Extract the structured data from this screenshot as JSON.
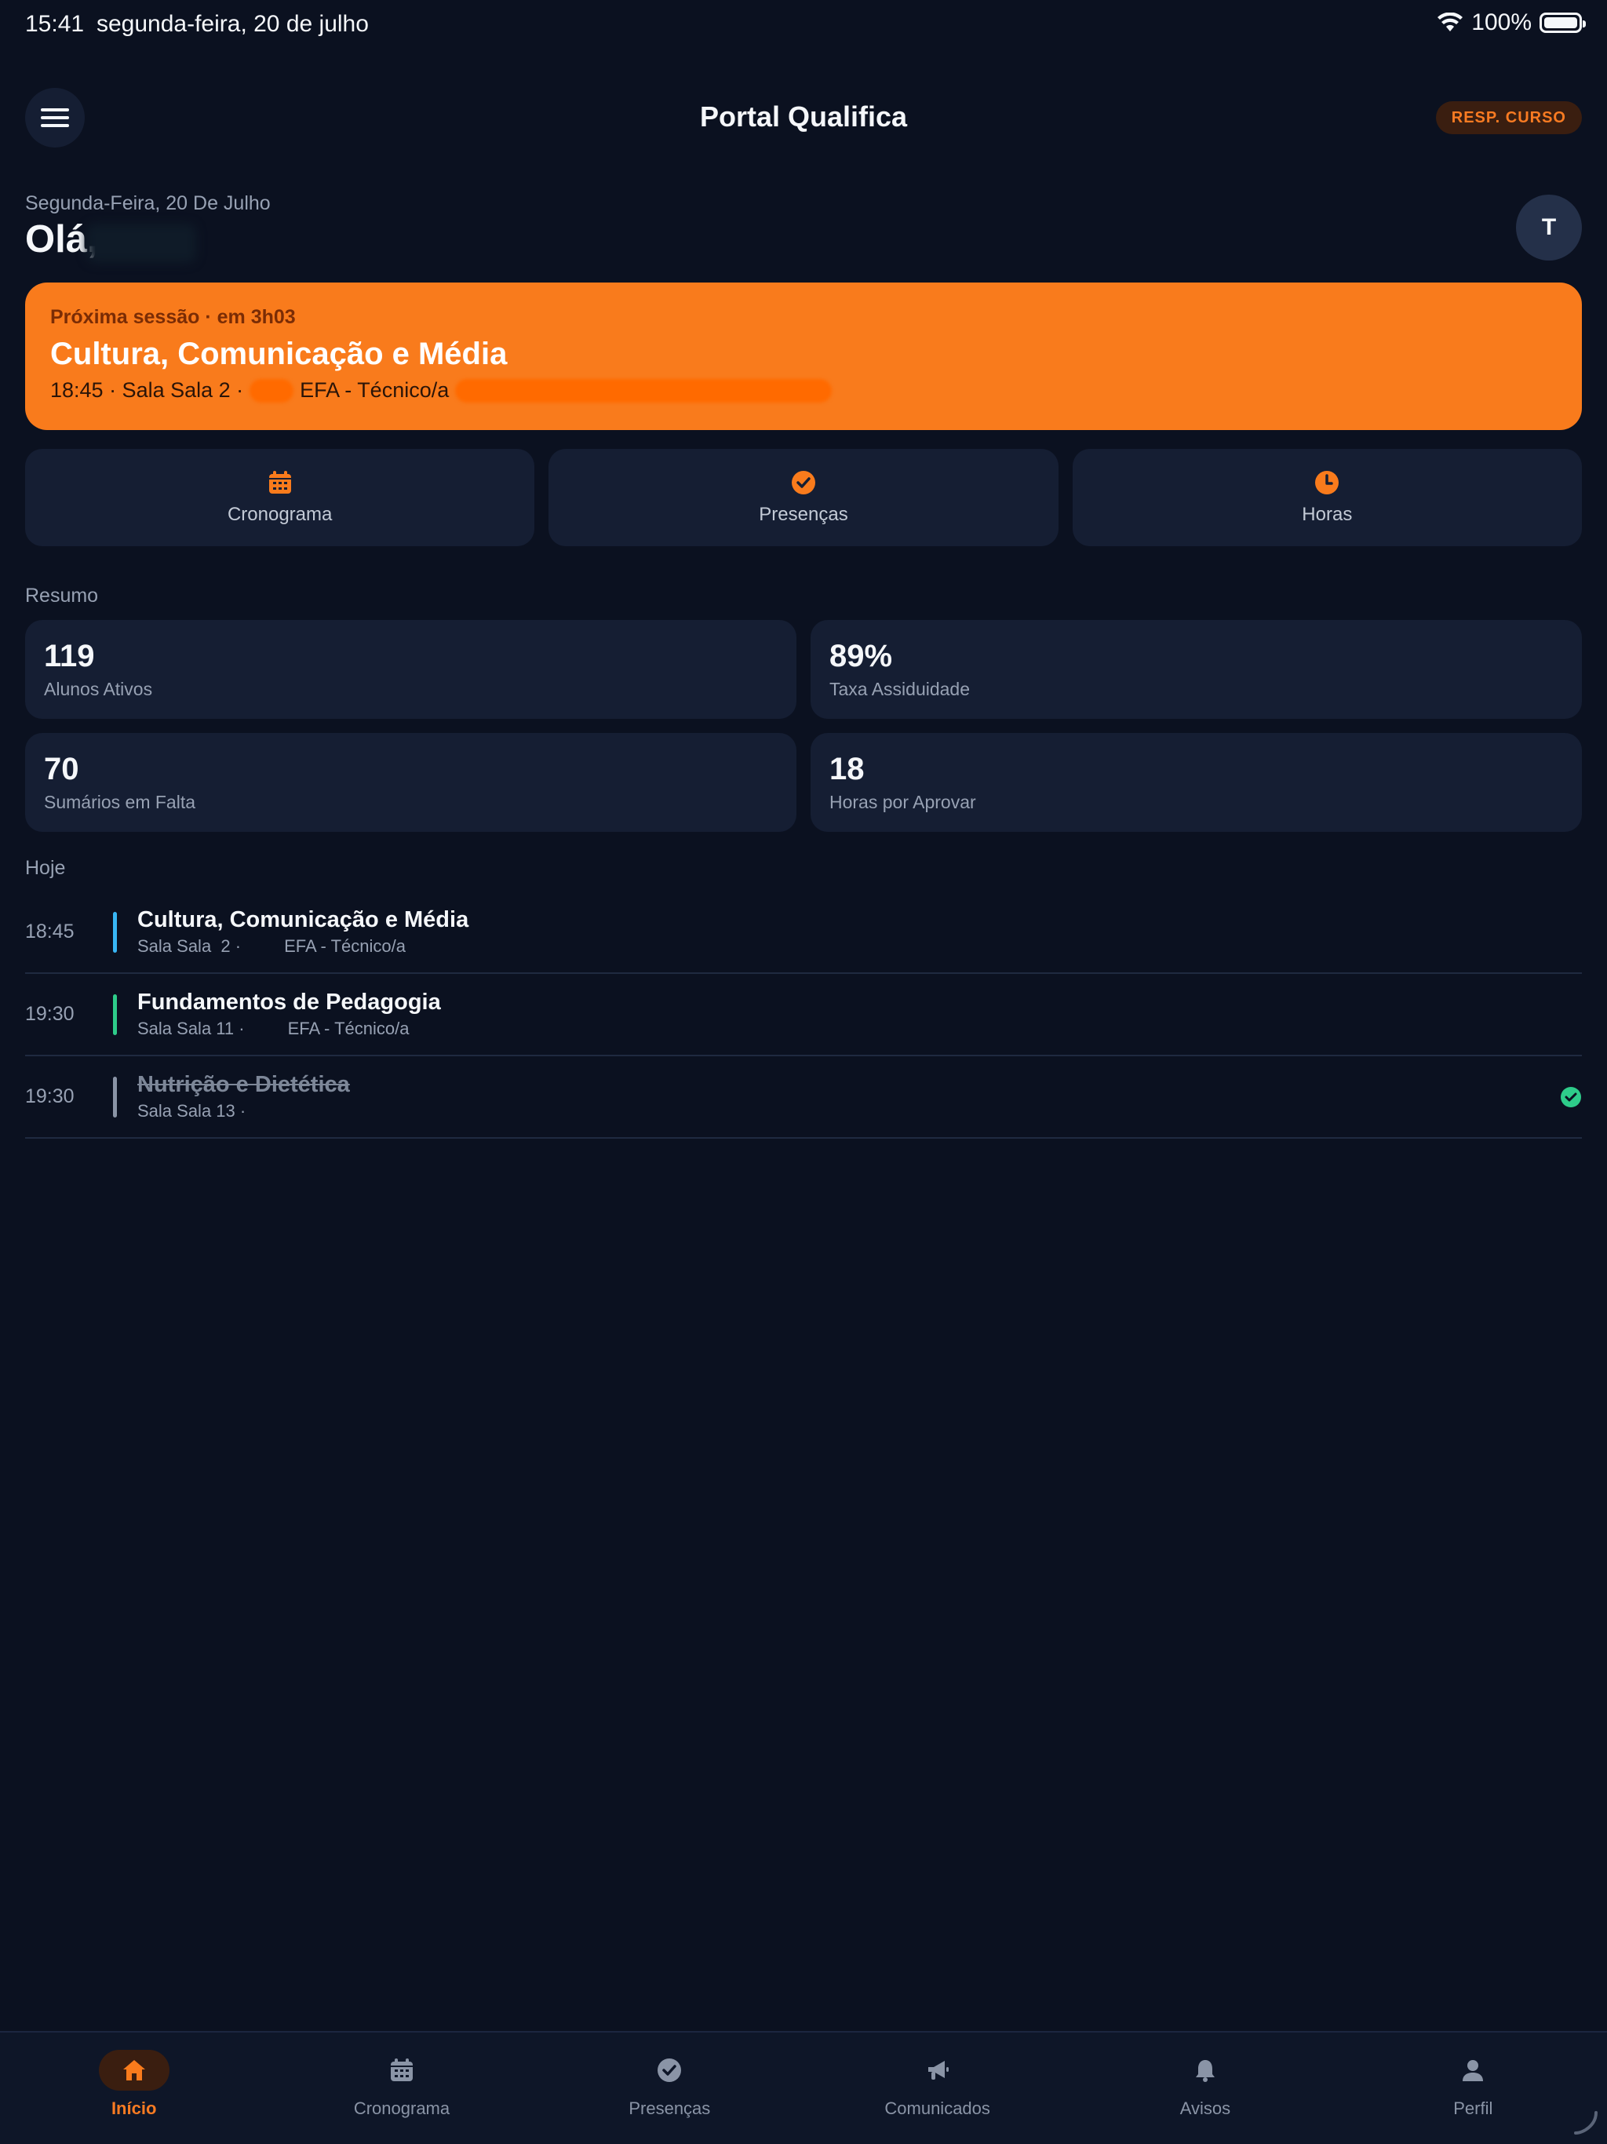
{
  "status_bar": {
    "time": "15:41",
    "date": "segunda-feira, 20 de julho",
    "battery": "100%"
  },
  "header": {
    "title": "Portal Qualifica",
    "role_badge": "RESP. CURSO"
  },
  "greeting": {
    "date": "Segunda-Feira, 20 De Julho",
    "hello": "Olá,",
    "avatar_initial": "T"
  },
  "next_session": {
    "label": "Próxima sessão · em 3h03",
    "title": "Cultura, Comunicação e Média",
    "meta_prefix": "18:45 · Sala Sala  2 ·",
    "meta_course": "EFA - Técnico/a"
  },
  "quick_actions": [
    {
      "label": "Cronograma",
      "icon": "calendar-icon"
    },
    {
      "label": "Presenças",
      "icon": "check-circle-icon"
    },
    {
      "label": "Horas",
      "icon": "clock-icon"
    }
  ],
  "summary": {
    "title": "Resumo",
    "stats": [
      {
        "value": "119",
        "label": "Alunos Ativos"
      },
      {
        "value": "89%",
        "label": "Taxa Assiduidade"
      },
      {
        "value": "70",
        "label": "Sumários em Falta"
      },
      {
        "value": "18",
        "label": "Horas por Aprovar"
      }
    ]
  },
  "today": {
    "title": "Hoje",
    "items": [
      {
        "time": "18:45",
        "title": "Cultura, Comunicação e Média",
        "subtitle": "Sala Sala  2 ·         EFA - Técnico/a",
        "color": "#38b6f5",
        "done": false
      },
      {
        "time": "19:30",
        "title": "Fundamentos de Pedagogia",
        "subtitle": "Sala Sala 11 ·         EFA - Técnico/a",
        "color": "#2ecc8a",
        "done": false
      },
      {
        "time": "19:30",
        "title": "Nutrição e Dietética",
        "subtitle": "Sala Sala 13 ·",
        "color": "#8a94a6",
        "done": true
      }
    ]
  },
  "tabs": [
    {
      "label": "Início",
      "icon": "home-icon",
      "active": true
    },
    {
      "label": "Cronograma",
      "icon": "calendar-icon",
      "active": false
    },
    {
      "label": "Presenças",
      "icon": "check-circle-icon",
      "active": false
    },
    {
      "label": "Comunicados",
      "icon": "megaphone-icon",
      "active": false
    },
    {
      "label": "Avisos",
      "icon": "bell-icon",
      "active": false
    },
    {
      "label": "Perfil",
      "icon": "person-icon",
      "active": false
    }
  ],
  "colors": {
    "accent": "#f97b1c",
    "background": "#0b1120",
    "card": "#151e33",
    "success": "#2ecc8a"
  }
}
